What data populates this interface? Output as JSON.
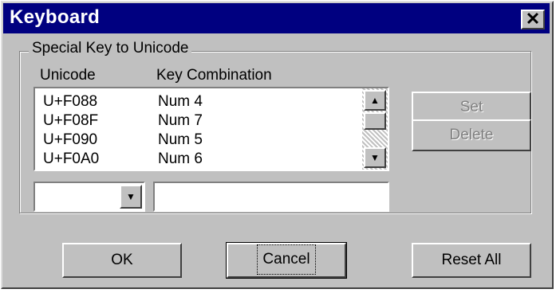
{
  "window": {
    "title": "Keyboard",
    "close_glyph": "✕",
    "close_icon": "close-icon"
  },
  "group": {
    "label": "Special Key to Unicode"
  },
  "columns": {
    "unicode": "Unicode",
    "key_combination": "Key Combination"
  },
  "list": {
    "rows": [
      {
        "unicode": "U+F088",
        "key": "Num 4"
      },
      {
        "unicode": "U+F08F",
        "key": "Num 7"
      },
      {
        "unicode": "U+F090",
        "key": "Num 5"
      },
      {
        "unicode": "U+F0A0",
        "key": "Num 6"
      }
    ],
    "scroll_up_glyph": "▲",
    "scroll_down_glyph": "▼"
  },
  "inputs": {
    "unicode_combo_value": "",
    "combo_arrow_glyph": "▼",
    "key_field_value": ""
  },
  "buttons": {
    "set": "Set",
    "delete": "Delete",
    "ok": "OK",
    "cancel": "Cancel",
    "reset_all": "Reset All"
  },
  "colors": {
    "titlebar": "#000080",
    "face": "#c0c0c0",
    "disabled_text": "#808080"
  }
}
